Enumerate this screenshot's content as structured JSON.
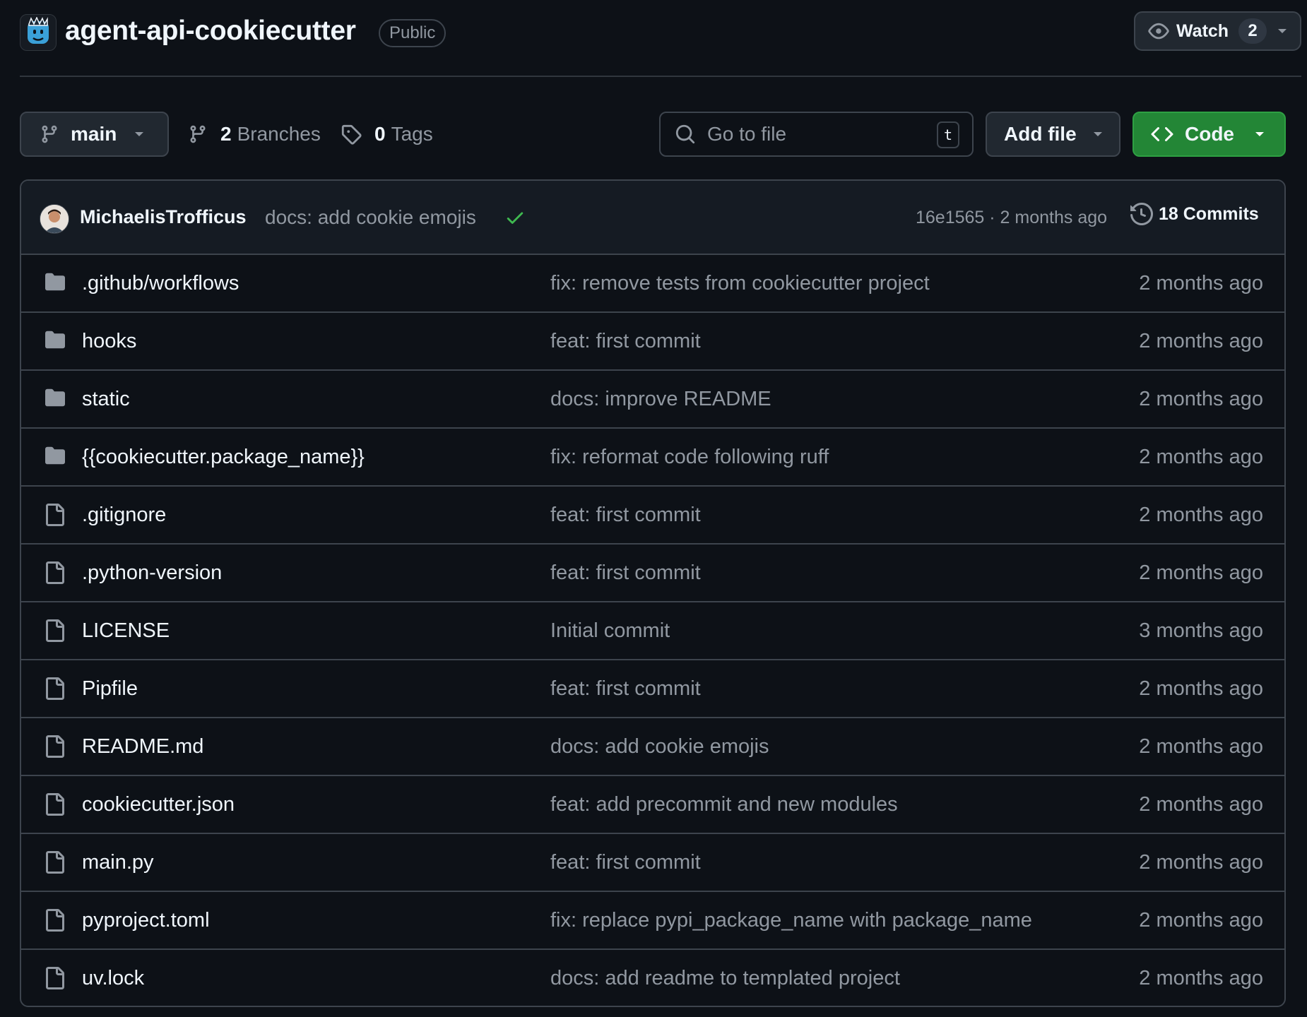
{
  "repo": {
    "name": "agent-api-cookiecutter",
    "visibility": "Public",
    "icon": "repo-logo-icon"
  },
  "watch": {
    "label": "Watch",
    "count": "2"
  },
  "toolbar": {
    "branch": "main",
    "branches_count": "2",
    "branches_label": "Branches",
    "tags_count": "0",
    "tags_label": "Tags",
    "search_placeholder": "Go to file",
    "search_shortcut": "t",
    "add_file_label": "Add file",
    "code_label": "Code"
  },
  "latest_commit": {
    "author": "MichaelisTrofficus",
    "message": "docs: add cookie emojis",
    "status": "check-icon",
    "meta": "16e1565 · 2 months ago",
    "commits_label": "18 Commits"
  },
  "files": [
    {
      "type": "folder",
      "name": ".github/workflows",
      "commit": "fix: remove tests from cookiecutter project",
      "date": "2 months ago"
    },
    {
      "type": "folder",
      "name": "hooks",
      "commit": "feat: first commit",
      "date": "2 months ago"
    },
    {
      "type": "folder",
      "name": "static",
      "commit": "docs: improve README",
      "date": "2 months ago"
    },
    {
      "type": "folder",
      "name": "{{cookiecutter.package_name}}",
      "commit": "fix: reformat code following ruff",
      "date": "2 months ago"
    },
    {
      "type": "file",
      "name": ".gitignore",
      "commit": "feat: first commit",
      "date": "2 months ago"
    },
    {
      "type": "file",
      "name": ".python-version",
      "commit": "feat: first commit",
      "date": "2 months ago"
    },
    {
      "type": "file",
      "name": "LICENSE",
      "commit": "Initial commit",
      "date": "3 months ago"
    },
    {
      "type": "file",
      "name": "Pipfile",
      "commit": "feat: first commit",
      "date": "2 months ago"
    },
    {
      "type": "file",
      "name": "README.md",
      "commit": "docs: add cookie emojis",
      "date": "2 months ago"
    },
    {
      "type": "file",
      "name": "cookiecutter.json",
      "commit": "feat: add precommit and new modules",
      "date": "2 months ago"
    },
    {
      "type": "file",
      "name": "main.py",
      "commit": "feat: first commit",
      "date": "2 months ago"
    },
    {
      "type": "file",
      "name": "pyproject.toml",
      "commit": "fix: replace pypi_package_name with package_name",
      "date": "2 months ago"
    },
    {
      "type": "file",
      "name": "uv.lock",
      "commit": "docs: add readme to templated project",
      "date": "2 months ago"
    }
  ],
  "colors": {
    "background": "#0d1117",
    "border": "#3d444d",
    "muted_text": "#9198a1",
    "primary_text": "#f0f6fc",
    "code_button": "#238636",
    "success": "#3fb950",
    "folder_icon": "#9198a1"
  }
}
